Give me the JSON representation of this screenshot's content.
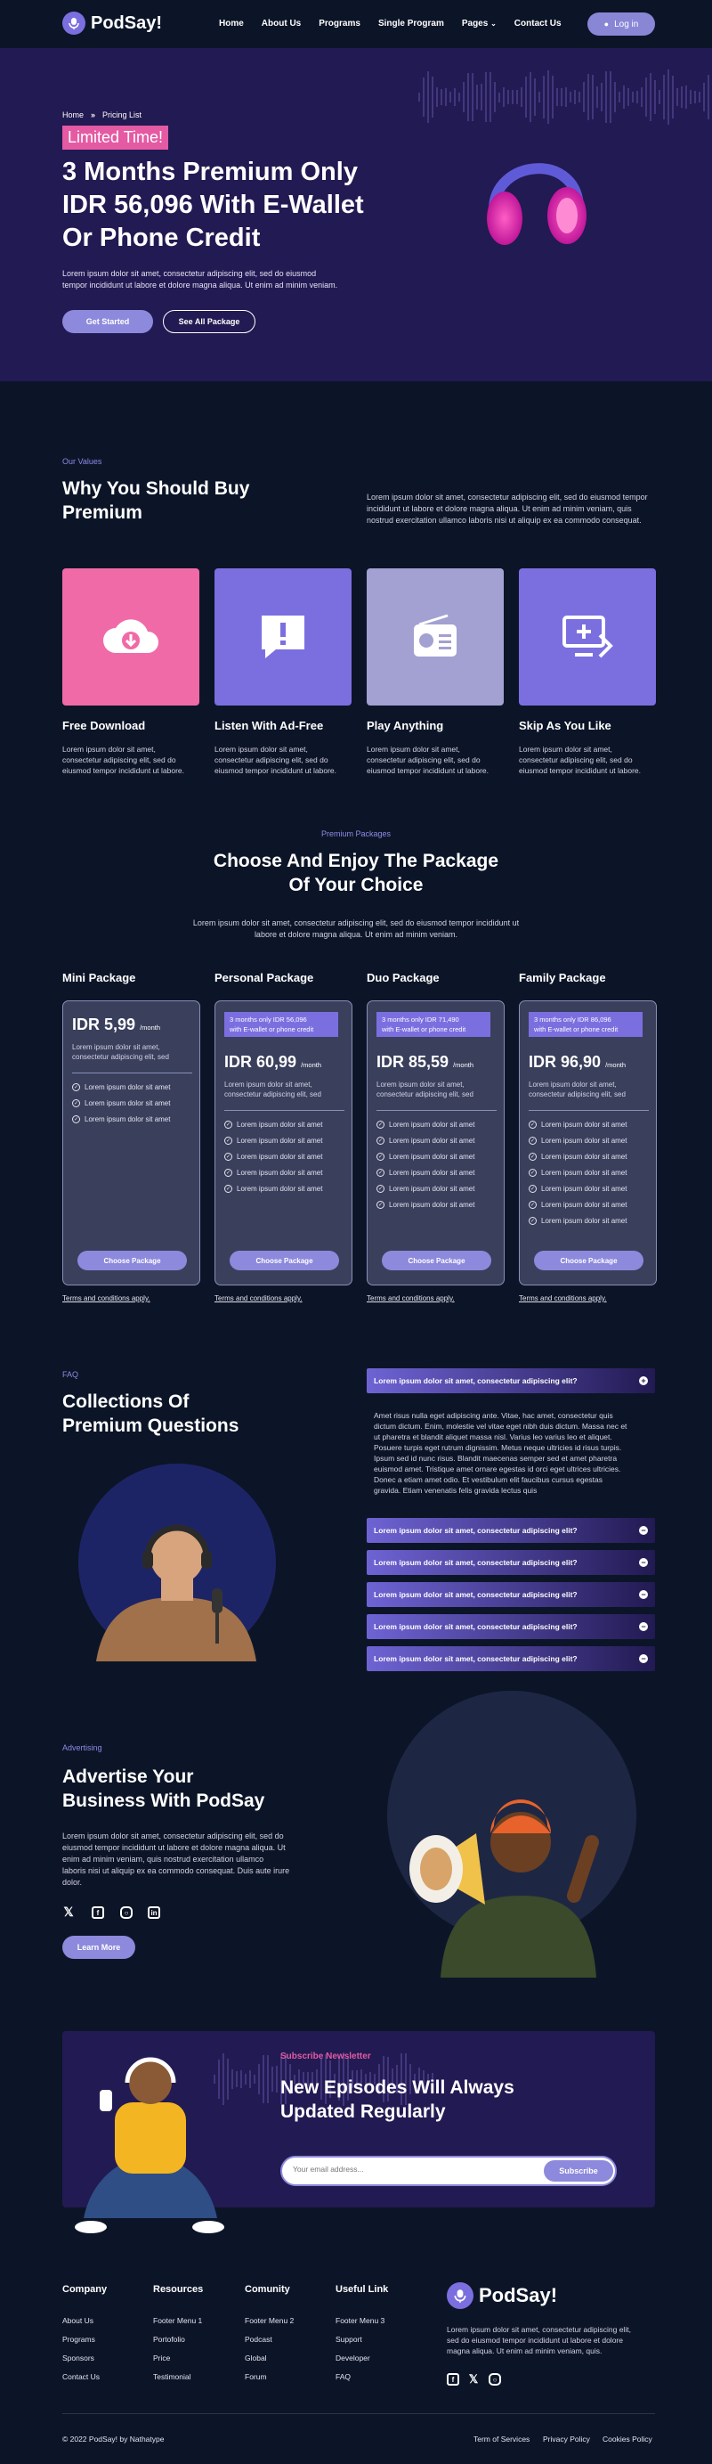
{
  "header": {
    "brand": "PodSay!",
    "nav": [
      "Home",
      "About Us",
      "Programs",
      "Single Program",
      "Pages",
      "Contact Us"
    ],
    "login_label": "Log in"
  },
  "hero": {
    "breadcrumb": {
      "home": "Home",
      "current": "Pricing List"
    },
    "badge": "Limited Time!",
    "title_line1": "3 Months Premium Only",
    "title_line2": "IDR 56,096 With E-Wallet",
    "title_line3": "Or Phone Credit",
    "desc_line1": "Lorem ipsum dolor sit amet, consectetur adipiscing elit, sed do eiusmod",
    "desc_line2": "tempor incididunt ut labore et dolore magna aliqua. Ut enim ad minim veniam.",
    "primary_label": "Get Started",
    "secondary_label": "See All Package"
  },
  "values": {
    "eyebrow": "Our Values",
    "title_line1": "Why You Should Buy",
    "title_line2": "Premium",
    "desc_line1": "Lorem ipsum dolor sit amet, consectetur adipiscing elit, sed do eiusmod tempor",
    "desc_line2": "incididunt ut labore et dolore magna aliqua. Ut enim ad minim veniam, quis",
    "desc_line3": "nostrud exercitation ullamco laboris nisi ut aliquip ex ea commodo consequat.",
    "items": [
      {
        "title": "Free Download",
        "icon": "cloud-download-icon",
        "color": "#f06aa8",
        "desc1": "Lorem ipsum dolor sit amet,",
        "desc2": "consectetur adipiscing elit, sed do",
        "desc3": "eiusmod tempor incididunt ut labore."
      },
      {
        "title": "Listen With Ad-Free",
        "icon": "alert-message-icon",
        "color": "#7b6fe0",
        "desc1": "Lorem ipsum dolor sit amet,",
        "desc2": "consectetur adipiscing elit, sed do",
        "desc3": "eiusmod tempor incididunt ut labore."
      },
      {
        "title": "Play Anything",
        "icon": "radio-icon",
        "color": "#a3a0d2",
        "desc1": "Lorem ipsum dolor sit amet,",
        "desc2": "consectetur adipiscing elit, sed do",
        "desc3": "eiusmod tempor incididunt ut labore."
      },
      {
        "title": "Skip As You Like",
        "icon": "screen-forward-icon",
        "color": "#7b6fe0",
        "desc1": "Lorem ipsum dolor sit amet,",
        "desc2": "consectetur adipiscing elit, sed do",
        "desc3": "eiusmod tempor incididunt ut labore."
      }
    ]
  },
  "packages": {
    "eyebrow": "Premium Packages",
    "title_line1": "Choose And Enjoy The Package",
    "title_line2": "Of Your Choice",
    "desc_line1": "Lorem ipsum dolor sit amet, consectetur adipiscing elit, sed do eiusmod tempor incididunt ut",
    "desc_line2": "labore et dolore magna aliqua. Ut enim ad minim veniam.",
    "feature_text": "Lorem ipsum dolor sit amet",
    "card_desc1": "Lorem ipsum dolor sit amet,",
    "card_desc2": "consectetur adipiscing elit, sed",
    "choose_label": "Choose Package",
    "terms_label": "Terms and conditions apply.",
    "plans": [
      {
        "name": "Mini Package",
        "price": "IDR 5,99",
        "period": "/month",
        "tag1": "",
        "tag2": "",
        "features": 3
      },
      {
        "name": "Personal Package",
        "price": "IDR 60,99",
        "period": "/month",
        "tag1": "3 months only IDR 56,096",
        "tag2": "with E-wallet or phone credit",
        "features": 5
      },
      {
        "name": "Duo Package",
        "price": "IDR 85,59",
        "period": "/month",
        "tag1": "3 months only IDR 71,490",
        "tag2": "with E-wallet or phone credit",
        "features": 6
      },
      {
        "name": "Family Package",
        "price": "IDR 96,90",
        "period": "/month",
        "tag1": "3 months only IDR 86,096",
        "tag2": "with E-wallet or phone credit",
        "features": 7
      }
    ]
  },
  "faq": {
    "eyebrow": "FAQ",
    "title_line1": "Collections Of",
    "title_line2": "Premium Questions",
    "question": "Lorem ipsum dolor sit amet, consectetur adipiscing elit?",
    "answer": [
      "Amet risus nulla eget adipiscing ante. Vitae, hac amet, consectetur quis",
      "dictum dictum. Enim, molestie vel vitae eget nibh duis dictum. Massa nec et",
      "ut pharetra et blandit aliquet massa nisl. Varius leo varius leo et aliquet.",
      "Posuere turpis eget rutrum dignissim. Metus neque ultricies id risus turpis.",
      "Ipsum sed id nunc risus. Blandit maecenas semper sed et amet pharetra",
      "euismod amet. Tristique amet ornare egestas id orci eget ultrices ultricies.",
      "Donec a etiam amet odio. Et vestibulum elit faucibus cursus egestas",
      "gravida. Etiam venenatis felis gravida lectus quis"
    ]
  },
  "advertise": {
    "eyebrow": "Advertising",
    "title_line1": "Advertise Your",
    "title_line2": "Business With PodSay",
    "desc": [
      "Lorem ipsum dolor sit amet, consectetur adipiscing elit, sed do",
      "eiusmod tempor incididunt ut labore et dolore magna aliqua. Ut",
      "enim ad minim veniam, quis nostrud exercitation ullamco",
      "laboris nisi ut aliquip ex ea commodo consequat. Duis aute irure",
      "dolor."
    ],
    "button_label": "Learn More"
  },
  "newsletter": {
    "eyebrow": "Subscribe Newsletter",
    "title_line1": "New Episodes Will Always",
    "title_line2": "Updated Regularly",
    "placeholder": "Your email address...",
    "button_label": "Subscribe"
  },
  "footer": {
    "columns": [
      {
        "title": "Company",
        "links": [
          "About Us",
          "Programs",
          "Sponsors",
          "Contact Us"
        ]
      },
      {
        "title": "Resources",
        "links": [
          "Footer Menu 1",
          "Portofolio",
          "Price",
          "Testimonial"
        ]
      },
      {
        "title": "Comunity",
        "links": [
          "Footer Menu 2",
          "Podcast",
          "Global",
          "Forum"
        ]
      },
      {
        "title": "Useful Link",
        "links": [
          "Footer Menu 3",
          "Support",
          "Developer",
          "FAQ"
        ]
      }
    ],
    "brand": "PodSay!",
    "desc": [
      "Lorem ipsum dolor sit amet, consectetur adipiscing elit,",
      "sed do eiusmod tempor incididunt ut labore et dolore",
      "magna aliqua. Ut enim ad minim veniam, quis."
    ],
    "copyright": "© 2022 PodSay! by Nathatype",
    "bottom_links": [
      "Term of Services",
      "Privacy Policy",
      "Cookies Policy"
    ]
  },
  "colors": {
    "accent": "#7b6fe0",
    "pink": "#e45aa3",
    "navy": "#0c1527",
    "purple_dark": "#221a52"
  }
}
